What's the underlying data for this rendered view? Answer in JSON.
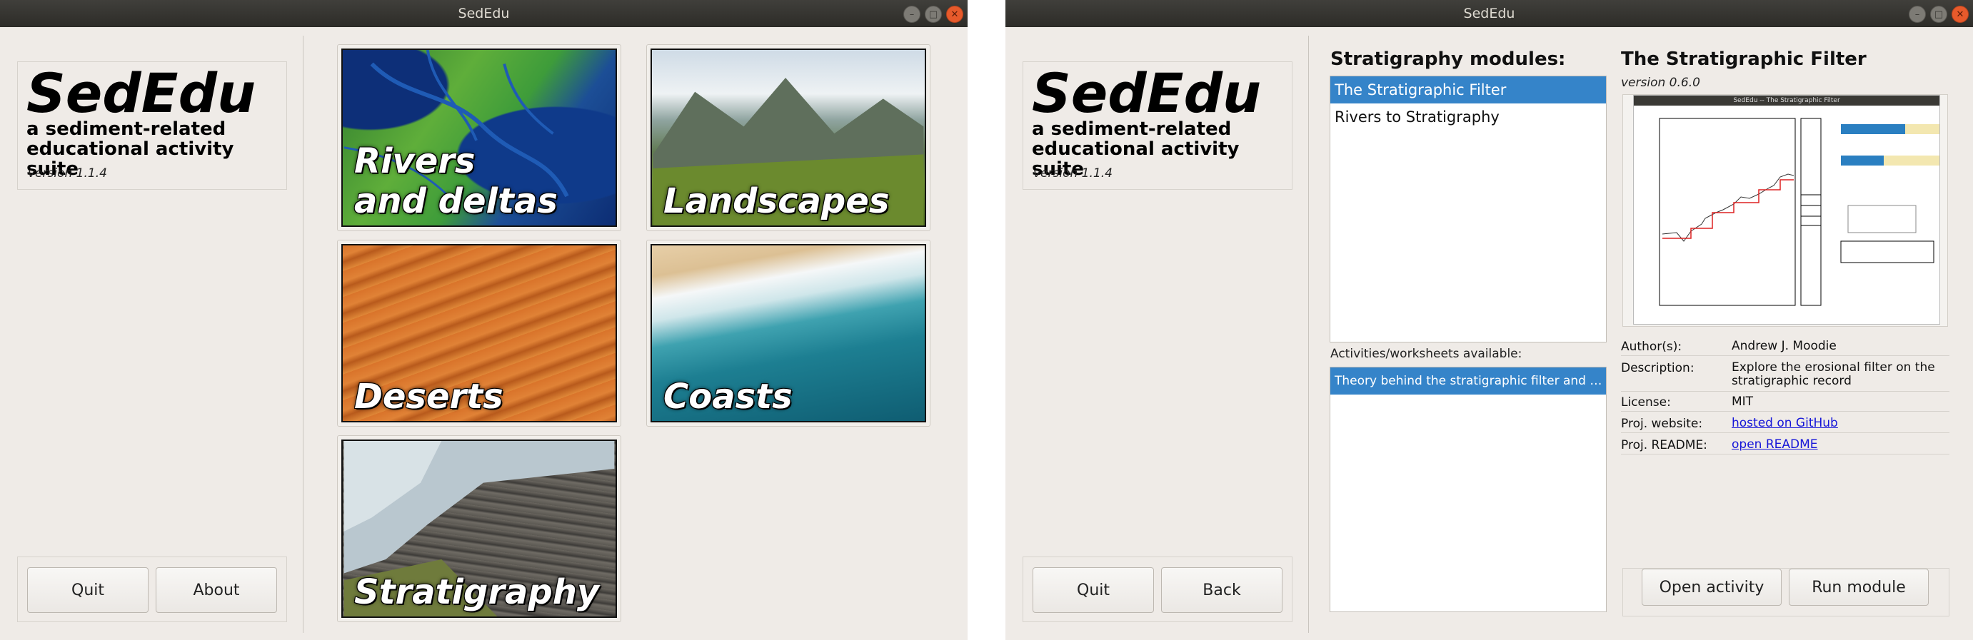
{
  "left_window": {
    "title": "SedEdu",
    "brand": {
      "name": "SedEdu",
      "subtitle_line1": "a sediment-related",
      "subtitle_line2": "educational activity suite",
      "version": "version 1.1.4"
    },
    "buttons": {
      "quit": "Quit",
      "about": "About"
    },
    "tiles": [
      {
        "label": "Rivers\nand deltas",
        "theme": "satellite-delta"
      },
      {
        "label": "Landscapes",
        "theme": "mountain-valley"
      },
      {
        "label": "Deserts",
        "theme": "sand-dunes"
      },
      {
        "label": "Coasts",
        "theme": "ocean-waves"
      },
      {
        "label": "Stratigraphy",
        "theme": "layered-cliff"
      }
    ]
  },
  "right_window": {
    "title": "SedEdu",
    "brand": {
      "name": "SedEdu",
      "subtitle_line1": "a sediment-related",
      "subtitle_line2": "educational activity suite",
      "version": "version 1.1.4"
    },
    "buttons": {
      "quit": "Quit",
      "back": "Back",
      "open_activity": "Open activity",
      "run_module": "Run module"
    },
    "modules_heading": "Stratigraphy modules:",
    "modules": [
      "The Stratigraphic Filter",
      "Rivers to Stratigraphy"
    ],
    "selected_module_index": 0,
    "activities_label": "Activities/worksheets available:",
    "activities": [
      "Theory behind the stratigraphic filter and the …"
    ],
    "detail": {
      "title": "The Stratigraphic Filter",
      "version": "version 0.6.0",
      "preview_window_title": "SedEdu -- The Stratigraphic Filter",
      "author_key": "Author(s):",
      "author": "Andrew J. Moodie",
      "description_key": "Description:",
      "description": "Explore the erosional filter on the stratigraphic record",
      "license_key": "License:",
      "license": "MIT",
      "website_key": "Proj. website:",
      "website": "hosted on GitHub",
      "readme_key": "Proj. README:",
      "readme": "open README"
    }
  },
  "colors": {
    "selection": "#3584c9",
    "window_bg": "#efebe7",
    "titlebar": "#333230",
    "close_button": "#e75a2b"
  },
  "icons": [
    "minimize-icon",
    "maximize-icon",
    "close-icon"
  ]
}
